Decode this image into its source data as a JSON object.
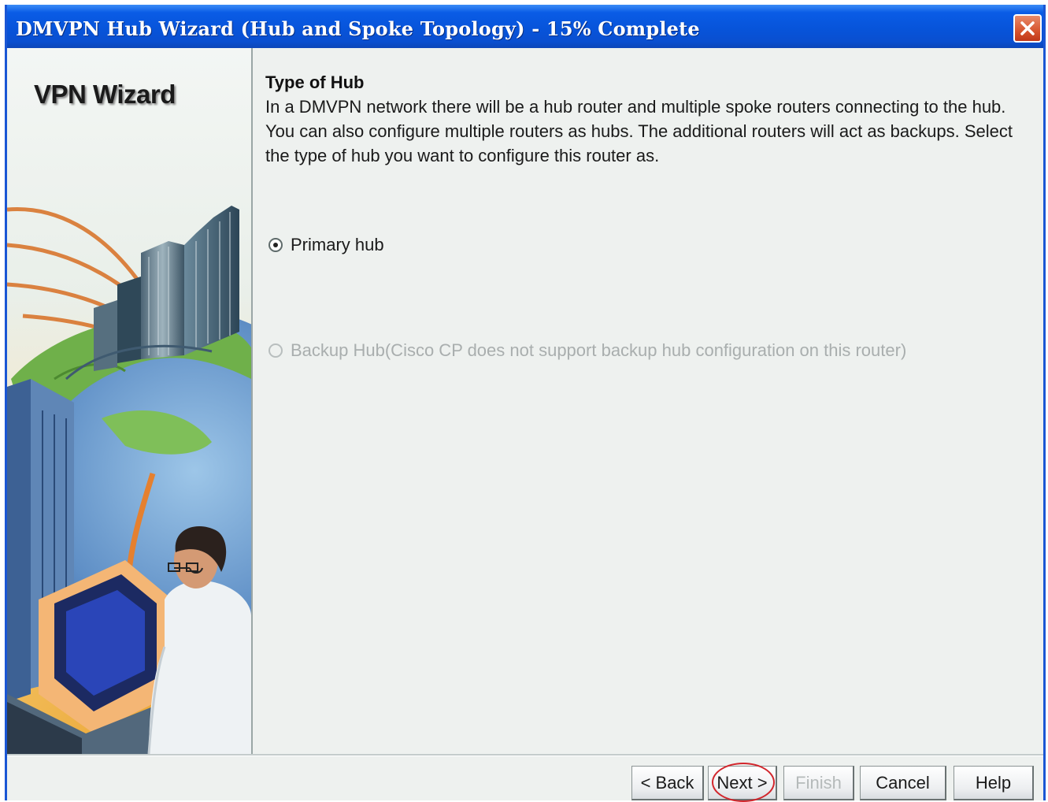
{
  "window": {
    "title": "DMVPN Hub Wizard (Hub and Spoke Topology) - 15% Complete",
    "progress_percent": 15
  },
  "sidebar": {
    "title": "VPN Wizard"
  },
  "main": {
    "section_title": "Type of Hub",
    "description": "In a DMVPN network there will be a hub router and multiple spoke routers connecting to the hub. You can also configure multiple routers as hubs. The additional routers will act as backups. Select the type of hub you want to configure this router as.",
    "options": [
      {
        "label": "Primary hub",
        "selected": true,
        "enabled": true
      },
      {
        "label": "Backup Hub(Cisco CP does not support backup hub configuration on this router)",
        "selected": false,
        "enabled": false
      }
    ]
  },
  "buttons": {
    "back": "< Back",
    "next": "Next >",
    "finish": "Finish",
    "cancel": "Cancel",
    "help": "Help"
  },
  "icons": {
    "close": "close-icon"
  },
  "colors": {
    "title_bar": "#0754da",
    "highlight_circle": "#d2262c",
    "close_button": "#d7542e"
  }
}
